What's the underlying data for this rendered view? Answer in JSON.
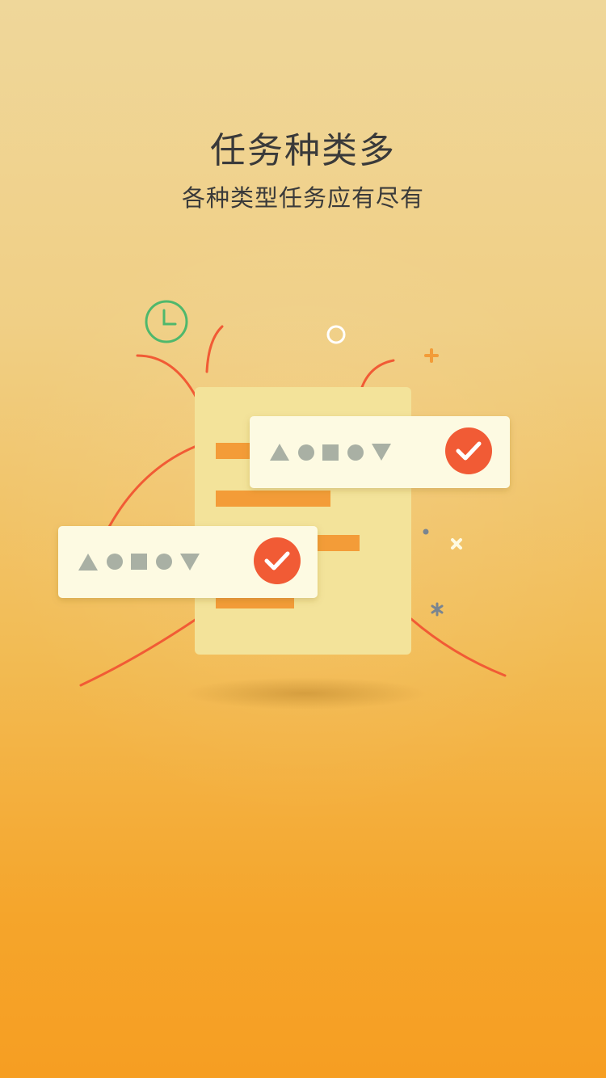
{
  "header": {
    "title": "任务种类多",
    "subtitle": "各种类型任务应有尽有"
  },
  "illustration": {
    "document": {
      "color": "#f3e39a"
    },
    "cards": [
      {
        "shapes": [
          "triangle-up",
          "circle",
          "square",
          "circle",
          "triangle-down"
        ],
        "status": "checked"
      },
      {
        "shapes": [
          "triangle-up",
          "circle",
          "square",
          "circle",
          "triangle-down"
        ],
        "status": "checked"
      }
    ],
    "decorations": [
      "clock-icon",
      "ring",
      "plus",
      "cross",
      "asterisk",
      "dot"
    ]
  },
  "colors": {
    "accent": "#f15b35",
    "bar": "#f39c38",
    "card": "#fdfae2",
    "shape": "#a9b0a4",
    "clock": "#4fb86c",
    "text": "#3a3a3a"
  }
}
